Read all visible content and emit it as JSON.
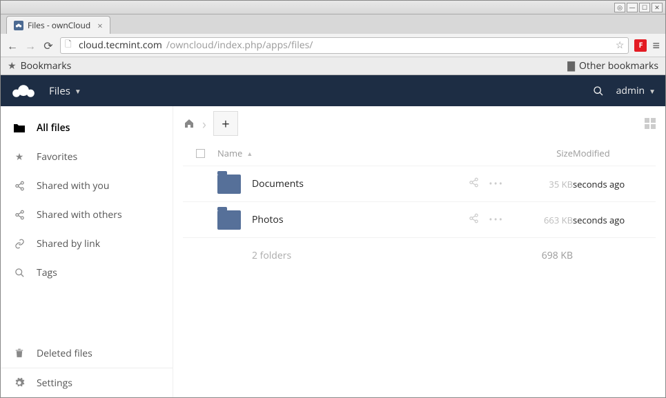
{
  "window": {
    "tab_title": "Files - ownCloud"
  },
  "browser": {
    "url_host": "cloud.tecmint.com",
    "url_path": "/owncloud/index.php/apps/files/",
    "bookmarks_label": "Bookmarks",
    "other_bookmarks_label": "Other bookmarks"
  },
  "header": {
    "app_name": "Files",
    "user": "admin"
  },
  "sidebar": {
    "items": [
      {
        "label": "All files",
        "icon": "folder-icon",
        "active": true
      },
      {
        "label": "Favorites",
        "icon": "star-icon",
        "active": false
      },
      {
        "label": "Shared with you",
        "icon": "share-icon",
        "active": false
      },
      {
        "label": "Shared with others",
        "icon": "share-icon",
        "active": false
      },
      {
        "label": "Shared by link",
        "icon": "link-icon",
        "active": false
      },
      {
        "label": "Tags",
        "icon": "search-icon",
        "active": false
      }
    ],
    "footer": [
      {
        "label": "Deleted files",
        "icon": "trash-icon"
      },
      {
        "label": "Settings",
        "icon": "gear-icon"
      }
    ]
  },
  "table": {
    "columns": {
      "name": "Name",
      "size": "Size",
      "modified": "Modified"
    },
    "rows": [
      {
        "name": "Documents",
        "size": "35 KB",
        "modified": "seconds ago"
      },
      {
        "name": "Photos",
        "size": "663 KB",
        "modified": "seconds ago"
      }
    ],
    "summary": {
      "text": "2 folders",
      "size": "698 KB"
    }
  }
}
